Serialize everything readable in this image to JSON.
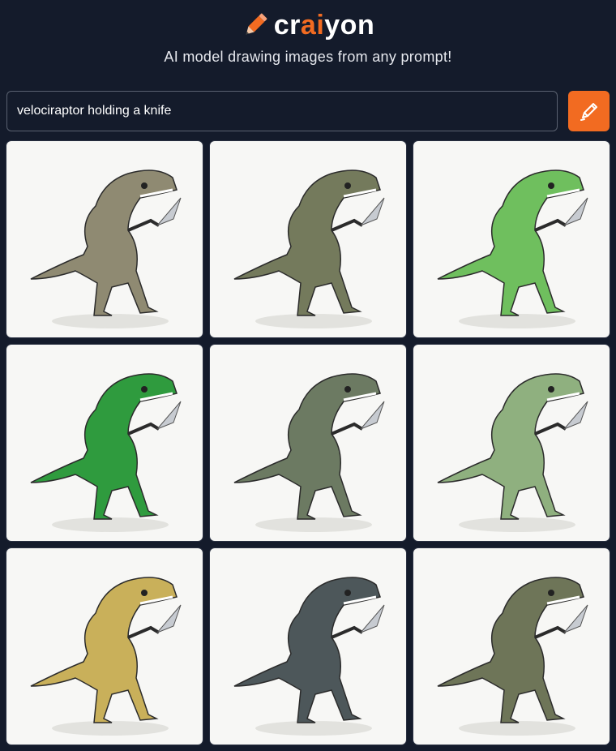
{
  "brand": {
    "prefix": "cr",
    "highlight": "ai",
    "suffix": "yon",
    "accent_color": "#f26b21",
    "icon": "pencil-icon"
  },
  "tagline": "AI model drawing images from any prompt!",
  "search": {
    "value": "velociraptor holding a knife",
    "button_icon": "pencil-draw-icon"
  },
  "results": [
    {
      "color": "#8f8a72"
    },
    {
      "color": "#747a5c"
    },
    {
      "color": "#6fbf5e"
    },
    {
      "color": "#2f9b3e"
    },
    {
      "color": "#6c7a62"
    },
    {
      "color": "#8fb07f"
    },
    {
      "color": "#c9b05a"
    },
    {
      "color": "#4d575a"
    },
    {
      "color": "#6e7558"
    }
  ]
}
